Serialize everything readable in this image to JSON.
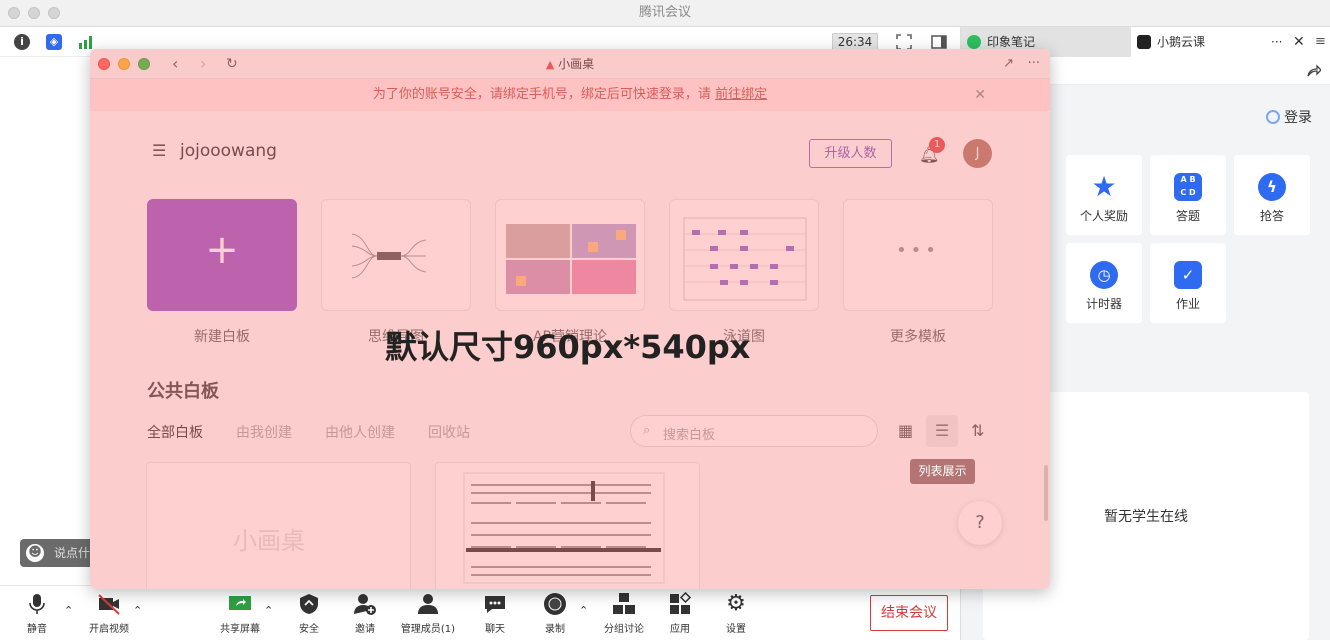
{
  "app": {
    "title": "腾讯会议"
  },
  "meeting": {
    "timer": "26:34",
    "chat_placeholder": "说点什",
    "toolbar": [
      {
        "key": "mute",
        "label": "静音",
        "icon": "microphone-icon"
      },
      {
        "key": "video",
        "label": "开启视频",
        "icon": "video-off-icon"
      },
      {
        "key": "share",
        "label": "共享屏幕",
        "icon": "share-screen-icon"
      },
      {
        "key": "security",
        "label": "安全",
        "icon": "shield-icon"
      },
      {
        "key": "invite",
        "label": "邀请",
        "icon": "add-user-icon"
      },
      {
        "key": "members",
        "label": "管理成员(1)",
        "icon": "members-icon"
      },
      {
        "key": "chat",
        "label": "聊天",
        "icon": "chat-icon"
      },
      {
        "key": "record",
        "label": "录制",
        "icon": "record-icon"
      },
      {
        "key": "breakout",
        "label": "分组讨论",
        "icon": "breakout-icon"
      },
      {
        "key": "apps",
        "label": "应用",
        "icon": "apps-icon"
      },
      {
        "key": "settings",
        "label": "设置",
        "icon": "gear-icon"
      }
    ],
    "end_label": "结束会议"
  },
  "right_panel": {
    "tabs": [
      {
        "label": "印象笔记"
      },
      {
        "label": "小鹅云课"
      }
    ],
    "login_label": "登录",
    "cards": [
      {
        "label": "个人奖励",
        "icon": "star-icon",
        "color": "#2f6bf0"
      },
      {
        "label": "答题",
        "icon": "quiz-icon",
        "color": "#2f6bf0"
      },
      {
        "label": "抢答",
        "icon": "lightning-icon",
        "color": "#2f6bf0"
      },
      {
        "label": "计时器",
        "icon": "stopwatch-icon",
        "color": "#2f6bf0"
      },
      {
        "label": "作业",
        "icon": "homework-icon",
        "color": "#2f6bf0"
      }
    ],
    "quiz_letters": [
      "A",
      "B",
      "C",
      "D"
    ],
    "no_students": "暂无学生在线"
  },
  "whiteboard": {
    "window_title": "小画桌",
    "notice_text": "为了你的账号安全，请绑定手机号，绑定后可快速登录，请",
    "notice_link": "前往绑定",
    "username": "jojooowang",
    "upgrade_label": "升级人数",
    "notification_count": "1",
    "avatar_letter": "J",
    "templates": [
      {
        "label": "新建白板"
      },
      {
        "label": "思维导图"
      },
      {
        "label": "AP营销理论"
      },
      {
        "label": "泳道图"
      },
      {
        "label": "更多模板"
      }
    ],
    "section_title": "公共白板",
    "filters": [
      {
        "label": "全部白板",
        "active": true
      },
      {
        "label": "由我创建",
        "active": false
      },
      {
        "label": "由他人创建",
        "active": false
      },
      {
        "label": "回收站",
        "active": false
      }
    ],
    "search_placeholder": "搜索白板",
    "tooltip": "列表展示",
    "help_label": "?",
    "board_logo": "小画桌",
    "overlay_text": "默认尺寸960px*540px"
  }
}
